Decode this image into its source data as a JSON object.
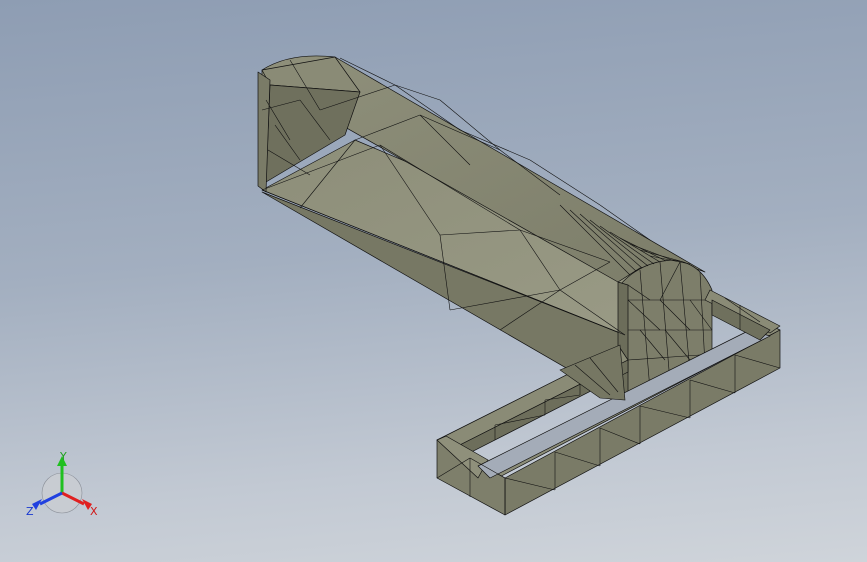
{
  "viewport": {
    "background_top": "#8e9db3",
    "background_bottom": "#cfd4da"
  },
  "model": {
    "face_color": "#858672",
    "face_light": "#9a9b87",
    "face_dark": "#6e6f5c",
    "edge_color": "#111111",
    "render_mode": "shaded-with-mesh-edges"
  },
  "triad": {
    "x_label": "X",
    "y_label": "Y",
    "z_label": "Z",
    "x_color": "#e02020",
    "y_color": "#20c020",
    "z_color": "#2040e0"
  }
}
